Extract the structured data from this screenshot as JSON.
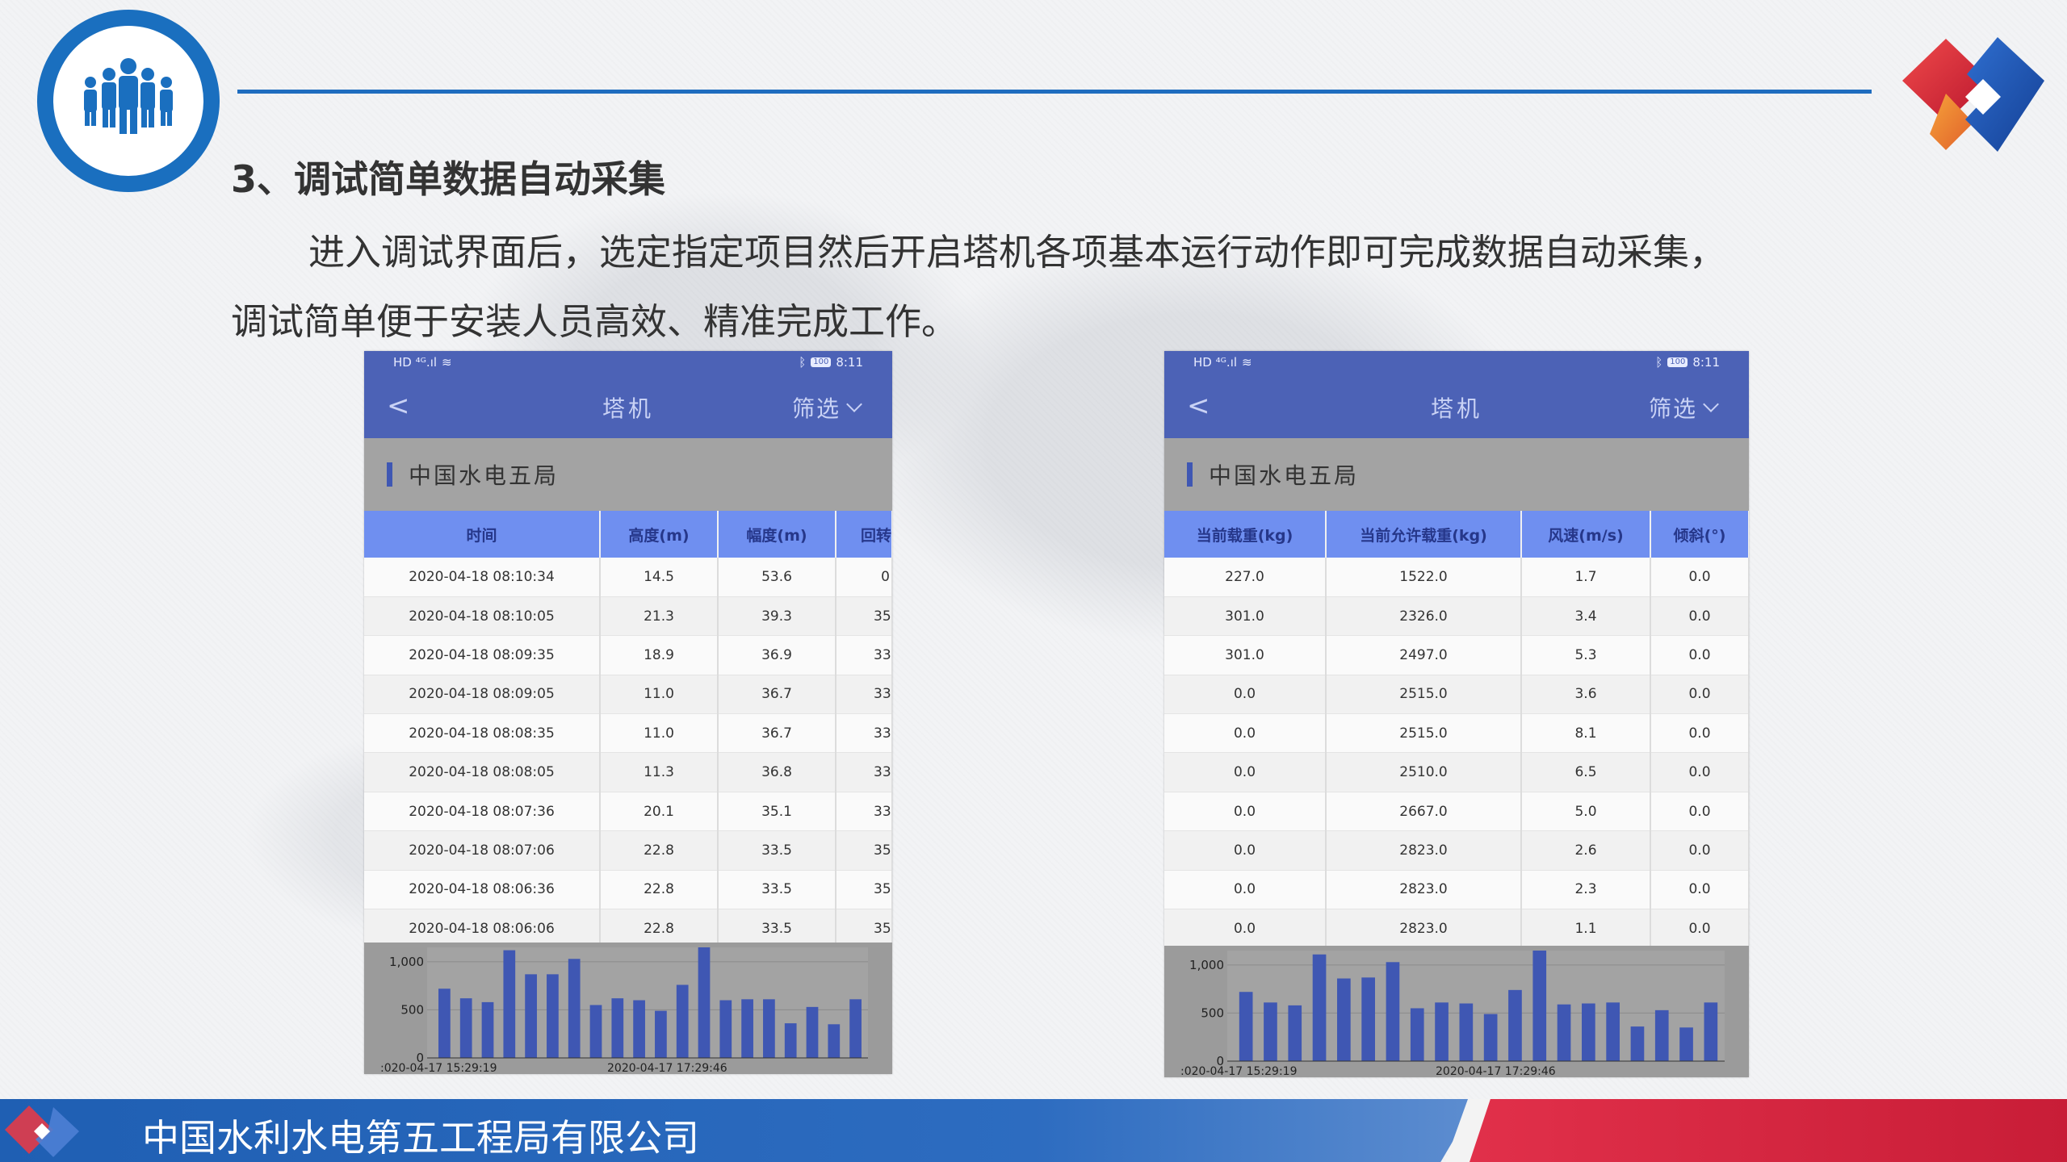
{
  "slide": {
    "section_title": "3、调试简单数据自动采集",
    "paragraph_line1": "进入调试界面后，选定指定项目然后开启塔机各项基本运行动作即可完成数据自动采集，",
    "paragraph_line2": "调试简单便于安装人员高效、精准完成工作。",
    "footer_company": "中国水利水电第五工程局有限公司"
  },
  "colors": {
    "header_blue": "#1f6dbf",
    "app_bar": "#4c62b6",
    "table_header": "#6f8ff0",
    "chart_bar": "#3f57b3",
    "footer_blue": "#1f5fb3",
    "footer_red": "#d62640"
  },
  "phone_left": {
    "status_left": "HD ⁴ᴳ.ıl",
    "status_right_battery": "100",
    "status_time": "8:11",
    "back_label": "<",
    "title": "塔机",
    "filter_label": "筛选",
    "org_name": "中国水电五局",
    "columns": [
      "时间",
      "高度(m)",
      "幅度(m)",
      "回转"
    ],
    "rows": [
      [
        "2020-04-18 08:10:34",
        "14.5",
        "53.6",
        "0"
      ],
      [
        "2020-04-18 08:10:05",
        "21.3",
        "39.3",
        "35"
      ],
      [
        "2020-04-18 08:09:35",
        "18.9",
        "36.9",
        "33"
      ],
      [
        "2020-04-18 08:09:05",
        "11.0",
        "36.7",
        "33"
      ],
      [
        "2020-04-18 08:08:35",
        "11.0",
        "36.7",
        "33"
      ],
      [
        "2020-04-18 08:08:05",
        "11.3",
        "36.8",
        "33"
      ],
      [
        "2020-04-18 08:07:36",
        "20.1",
        "35.1",
        "33"
      ],
      [
        "2020-04-18 08:07:06",
        "22.8",
        "33.5",
        "35"
      ],
      [
        "2020-04-18 08:06:36",
        "22.8",
        "33.5",
        "35"
      ],
      [
        "2020-04-18 08:06:06",
        "22.8",
        "33.5",
        "35"
      ]
    ]
  },
  "phone_right": {
    "status_left": "HD ⁴ᴳ.ıl",
    "status_right_battery": "100",
    "status_time": "8:11",
    "back_label": "<",
    "title": "塔机",
    "filter_label": "筛选",
    "org_name": "中国水电五局",
    "columns": [
      "当前载重(kg)",
      "当前允许载重(kg)",
      "风速(m/s)",
      "倾斜(°)"
    ],
    "rows": [
      [
        "227.0",
        "1522.0",
        "1.7",
        "0.0"
      ],
      [
        "301.0",
        "2326.0",
        "3.4",
        "0.0"
      ],
      [
        "301.0",
        "2497.0",
        "5.3",
        "0.0"
      ],
      [
        "0.0",
        "2515.0",
        "3.6",
        "0.0"
      ],
      [
        "0.0",
        "2515.0",
        "8.1",
        "0.0"
      ],
      [
        "0.0",
        "2510.0",
        "6.5",
        "0.0"
      ],
      [
        "0.0",
        "2667.0",
        "5.0",
        "0.0"
      ],
      [
        "0.0",
        "2823.0",
        "2.6",
        "0.0"
      ],
      [
        "0.0",
        "2823.0",
        "2.3",
        "0.0"
      ],
      [
        "0.0",
        "2823.0",
        "1.1",
        "0.0"
      ]
    ]
  },
  "chart_data": [
    {
      "type": "bar",
      "ylim": [
        0,
        1150
      ],
      "y_ticks": [
        "0",
        "500",
        "1,000"
      ],
      "x_tick_labels": [
        ":020-04-17 15:29:19",
        "2020-04-17 17:29:46"
      ],
      "values": [
        720,
        620,
        580,
        1120,
        870,
        870,
        1030,
        550,
        620,
        600,
        490,
        760,
        1200,
        600,
        610,
        610,
        360,
        530,
        350,
        610
      ]
    },
    {
      "type": "bar",
      "ylim": [
        0,
        1150
      ],
      "y_ticks": [
        "0",
        "500",
        "1,000"
      ],
      "x_tick_labels": [
        ":020-04-17 15:29:19",
        "2020-04-17 17:29:46"
      ],
      "values": [
        720,
        610,
        580,
        1110,
        860,
        870,
        1030,
        550,
        610,
        600,
        490,
        740,
        1200,
        590,
        600,
        610,
        360,
        530,
        350,
        610
      ]
    }
  ]
}
